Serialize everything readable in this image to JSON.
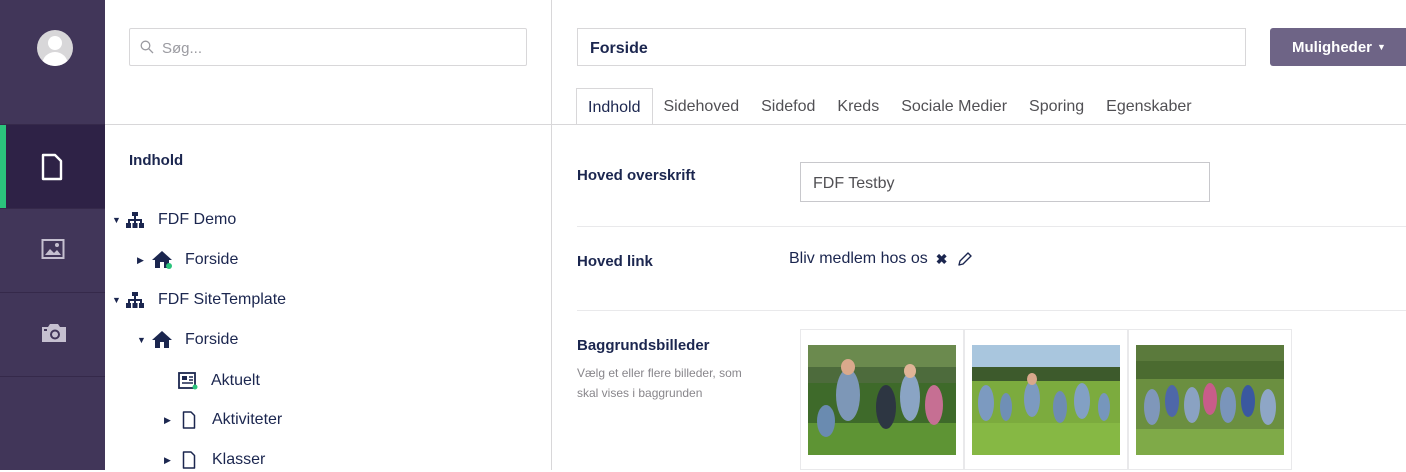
{
  "rail": {
    "sections": [
      {
        "name": "content-section",
        "icon": "document-icon",
        "active": true
      },
      {
        "name": "media-section",
        "icon": "image-icon",
        "active": false
      },
      {
        "name": "photo-section",
        "icon": "camera-icon",
        "active": false
      }
    ]
  },
  "tree": {
    "search_placeholder": "Søg...",
    "title": "Indhold",
    "nodes": [
      {
        "label": "FDF Demo",
        "icon": "sitemap-icon",
        "expanded": true
      },
      {
        "label": "Forside",
        "icon": "home-icon",
        "expanded": false
      },
      {
        "label": "FDF SiteTemplate",
        "icon": "sitemap-icon",
        "expanded": true
      },
      {
        "label": "Forside",
        "icon": "home-icon",
        "expanded": true
      },
      {
        "label": "Aktuelt",
        "icon": "newspaper-icon",
        "expanded": false
      },
      {
        "label": "Aktiviteter",
        "icon": "document-icon",
        "expanded": false
      },
      {
        "label": "Klasser",
        "icon": "document-icon",
        "expanded": false
      }
    ]
  },
  "editor": {
    "page_name": "Forside",
    "options_label": "Muligheder",
    "tabs": [
      "Indhold",
      "Sidehoved",
      "Sidefod",
      "Kreds",
      "Sociale Medier",
      "Sporing",
      "Egenskaber"
    ],
    "active_tab": "Indhold",
    "properties": {
      "headline": {
        "label": "Hoved overskrift",
        "value": "FDF Testby"
      },
      "main_link": {
        "label": "Hoved link",
        "value": "Bliv medlem hos os",
        "remove_symbol": "✖"
      },
      "backgrounds": {
        "label": "Baggrundsbilleder",
        "description": "Vælg et eller flere billeder, som skal vises i baggrunden",
        "image_count": 3
      }
    }
  },
  "colors": {
    "rail_bg": "#413659",
    "rail_active": "#2e2246",
    "accent_green": "#2bc37c",
    "button_bg": "#6e6486",
    "text_dark": "#1b264f"
  }
}
